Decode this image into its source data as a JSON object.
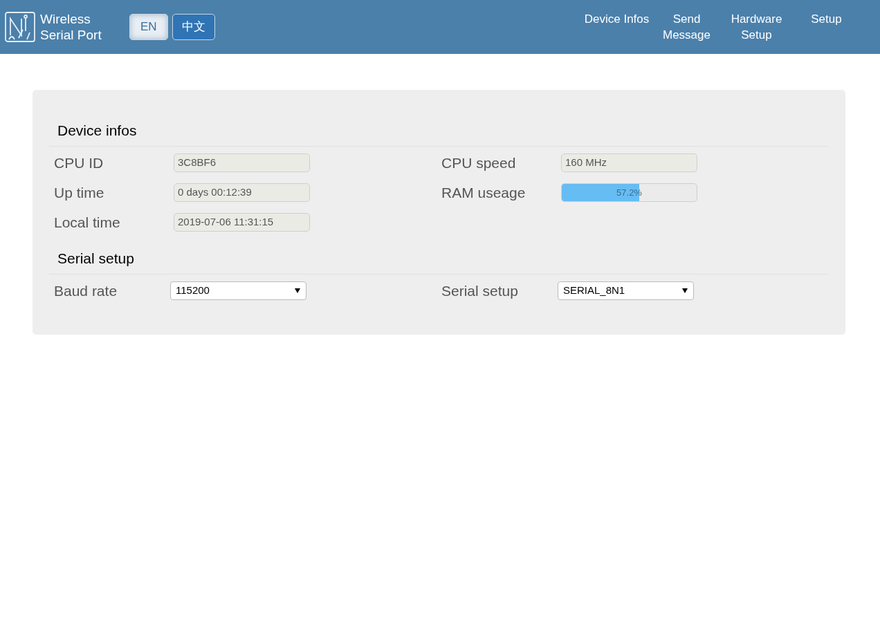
{
  "header": {
    "brand": "Wireless Serial Port",
    "languages": [
      {
        "label": "EN",
        "selected": true
      },
      {
        "label": "中文",
        "selected": false
      }
    ],
    "nav": [
      {
        "label": "Device Infos"
      },
      {
        "label": "Send Message"
      },
      {
        "label": "Hardware Setup"
      },
      {
        "label": "Setup"
      }
    ]
  },
  "sections": [
    {
      "title": "Device infos",
      "fields": [
        {
          "kind": "text",
          "label": "CPU ID",
          "value": "3C8BF6"
        },
        {
          "kind": "text",
          "label": "CPU speed",
          "value": "160 MHz"
        },
        {
          "kind": "text",
          "label": "Up time",
          "value": "0 days 00:12:39"
        },
        {
          "kind": "progress",
          "label": "RAM useage",
          "value": "57.2%",
          "level": 0.572
        },
        {
          "kind": "text",
          "label": "Local time",
          "value": "2019-07-06 11:31:15"
        }
      ]
    },
    {
      "title": "Serial setup",
      "fields": [
        {
          "kind": "select",
          "label": "Baud rate",
          "value": "115200"
        },
        {
          "kind": "select",
          "label": "Serial setup",
          "value": "SERIAL_8N1"
        }
      ]
    }
  ]
}
